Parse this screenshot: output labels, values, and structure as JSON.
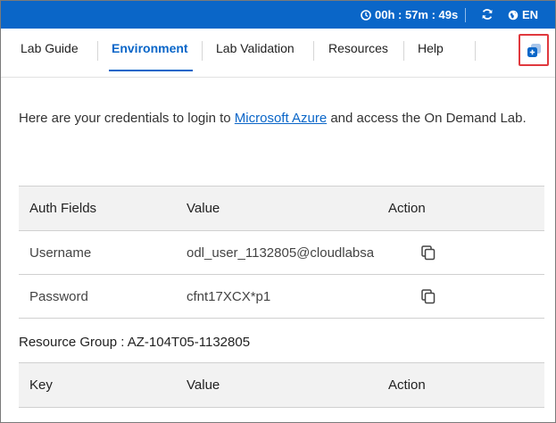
{
  "topbar": {
    "timer": "00h : 57m : 49s",
    "language": "EN",
    "clock_icon": "clock-icon",
    "refresh_icon": "refresh-icon",
    "globe_icon": "globe-icon",
    "background": "#0a66c8"
  },
  "tabs": [
    {
      "label": "Lab Guide",
      "active": false
    },
    {
      "label": "Environment",
      "active": true
    },
    {
      "label": "Lab Validation",
      "active": false
    },
    {
      "label": "Resources",
      "active": false
    },
    {
      "label": "Help",
      "active": false
    }
  ],
  "popout_icon": "popout-window-icon",
  "intro": {
    "before": "Here are your credentials to login to ",
    "link": "Microsoft Azure",
    "after": " and access the On Demand Lab."
  },
  "credentials": {
    "headers": [
      "Auth Fields",
      "Value",
      "Action"
    ],
    "rows": [
      {
        "field": "Username",
        "value": "odl_user_1132805@cloudlabsa"
      },
      {
        "field": "Password",
        "value": "cfnt17XCX*p1"
      }
    ],
    "copy_icon": "copy-icon"
  },
  "resource_group": {
    "label": "Resource Group : AZ-104T05-1132805",
    "headers": [
      "Key",
      "Value",
      "Action"
    ]
  },
  "colors": {
    "accent": "#0a66c8",
    "highlight_border": "#e0393e"
  }
}
